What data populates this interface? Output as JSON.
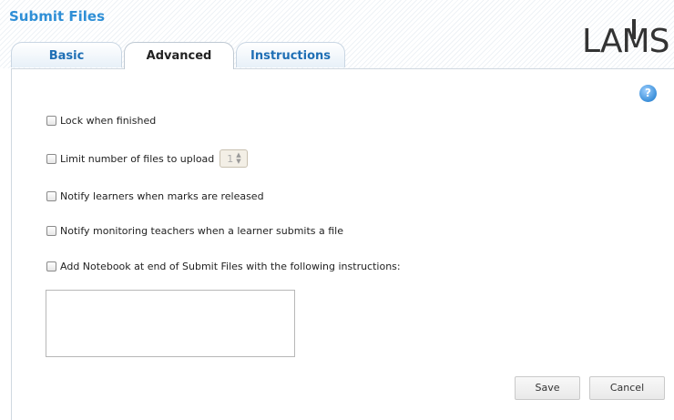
{
  "header": {
    "title": "Submit Files",
    "logo_text": "LAMS"
  },
  "tabs": [
    {
      "label": "Basic",
      "active": false
    },
    {
      "label": "Advanced",
      "active": true
    },
    {
      "label": "Instructions",
      "active": false
    }
  ],
  "help_icon": {
    "glyph": "?"
  },
  "options": [
    {
      "label": "Lock when finished",
      "checked": false
    },
    {
      "label": "Limit number of files to upload",
      "checked": false,
      "stepper_value": "1"
    },
    {
      "label": "Notify learners when marks are released",
      "checked": false
    },
    {
      "label": "Notify monitoring teachers when a learner submits a file",
      "checked": false
    },
    {
      "label": "Add Notebook at end of Submit Files with the following instructions:",
      "checked": false
    }
  ],
  "notebook_instructions": {
    "value": ""
  },
  "buttons": {
    "save": "Save",
    "cancel": "Cancel"
  },
  "colors": {
    "title": "#2f8fd6",
    "tab_text": "#1f6fb5",
    "help": "#3b8fd9"
  }
}
